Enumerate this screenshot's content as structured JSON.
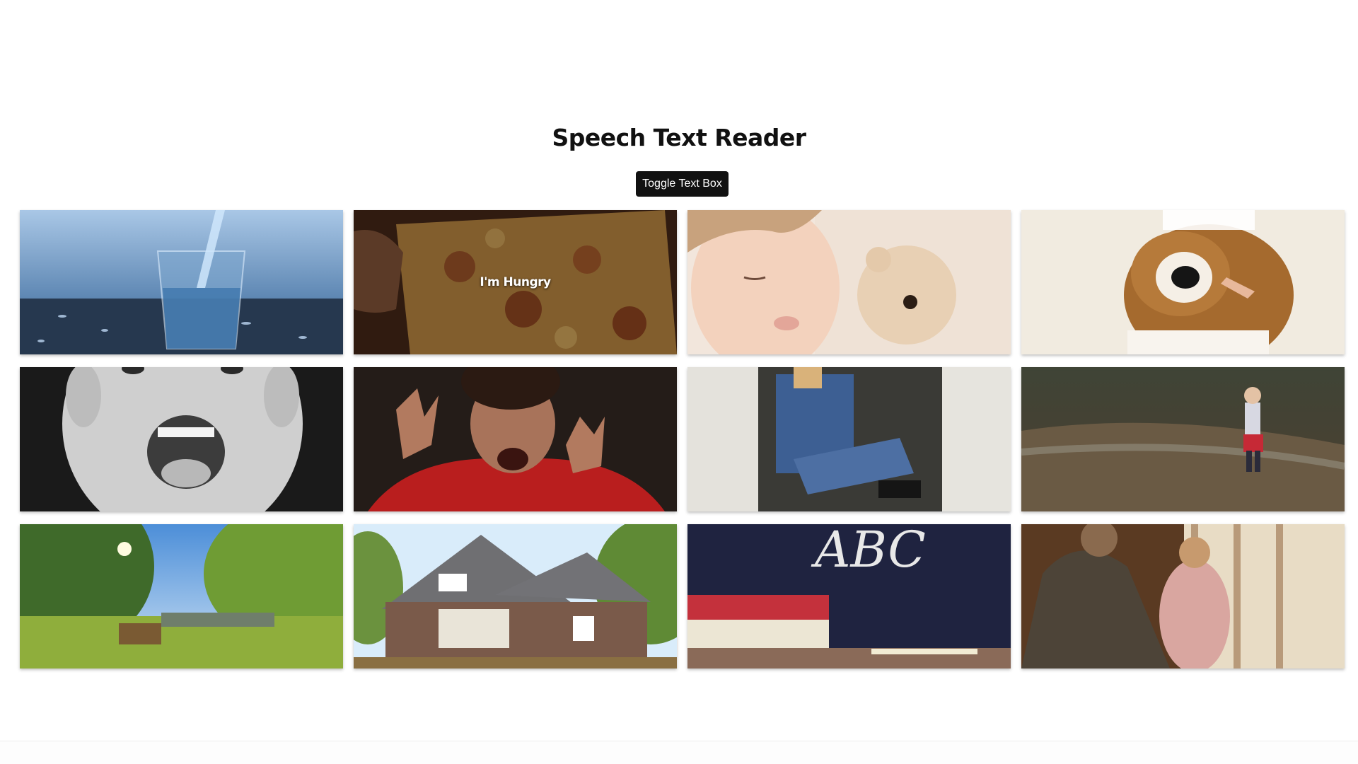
{
  "app": {
    "heading": "Speech Text Reader",
    "toggle_label": "Toggle Text Box"
  },
  "grid": {
    "cards": [
      {
        "caption": ""
      },
      {
        "caption": "I'm Hungry"
      },
      {
        "caption": ""
      },
      {
        "caption": ""
      },
      {
        "caption": ""
      },
      {
        "caption": ""
      },
      {
        "caption": ""
      },
      {
        "caption": ""
      },
      {
        "caption": ""
      },
      {
        "caption": ""
      },
      {
        "caption": ""
      },
      {
        "caption": ""
      }
    ],
    "chalkboard_text": "ABC"
  },
  "colors": {
    "button_bg": "#111111",
    "button_text": "#ffffff",
    "heading": "#111111"
  }
}
